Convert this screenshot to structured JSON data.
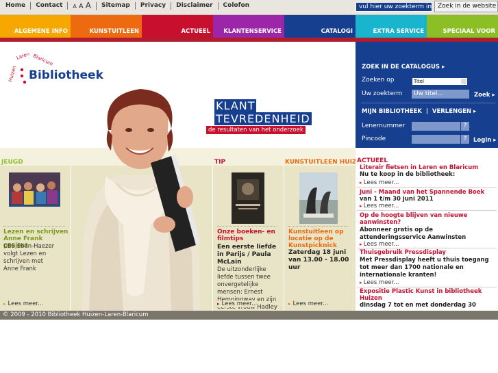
{
  "topnav": {
    "items": [
      "Home",
      "Contact",
      "Sitemap",
      "Privacy",
      "Disclaimer",
      "Colofon"
    ],
    "font_sizes": [
      "A",
      "A",
      "A"
    ]
  },
  "search": {
    "placeholder": "vul hier uw zoekterm in",
    "button": "Zoek in de website"
  },
  "colornav": [
    {
      "label": "ALGEMENE INFO",
      "color": "#f6a800"
    },
    {
      "label": "KUNSTUITLEEN",
      "color": "#ee6a10"
    },
    {
      "label": "ACTUEEL",
      "color": "#c8102e"
    },
    {
      "label": "KLANTENSERVICE",
      "color": "#9b27a8"
    },
    {
      "label": "CATALOGI",
      "color": "#173f8f"
    },
    {
      "label": "EXTRA SERVICE",
      "color": "#19b5cf"
    },
    {
      "label": "SPECIAAL VOOR",
      "color": "#8cbf26"
    }
  ],
  "logo": {
    "name": "Bibliotheek",
    "arc": "Huizen • Laren • Blaricum"
  },
  "banner": {
    "line1": "KLANT",
    "line2": "TEVREDENHEID",
    "line3": "de resultaten van het onderzoek"
  },
  "catalog_panel": {
    "heading": "ZOEK IN DE CATALOGUS",
    "search_on_label": "Zoeken op",
    "search_on_value": "Titel",
    "term_label": "Uw zoekterm",
    "term_placeholder": "Uw titel...",
    "search_button": "Zoek",
    "my_library": "MIJN BIBLIOTHEEK",
    "extend": "VERLENGEN",
    "member_label": "Lenernummer",
    "pin_label": "Pincode",
    "help": "?",
    "login_button": "Login"
  },
  "columns": {
    "jeugd": {
      "heading": "JEUGD",
      "title": "Lezen en schrijven Anne Frank project",
      "text": "CBS Eben-Haezer volgt Lezen en schrijven met Anne Frank",
      "more": "Lees meer..."
    },
    "tip": {
      "heading": "TIP",
      "title": "Onze boeken- en filmtips",
      "subtitle": "Een eerste liefde in Parijs / Paula McLain",
      "text": "De uitzonderlijke liefde tussen twee onvergetelijke mensen: Ernest Hemningway en zijn eerste vrouw Hadley",
      "more": "Lees meer..."
    },
    "kunst": {
      "heading": "KUNSTUITLEEN HUIZEN",
      "title": "Kunstuitleen op locatie op de Kunstpicknick",
      "text": "Zaterdag 18 juni van 13.00 - 18.00 uur",
      "more": "Lees meer..."
    }
  },
  "actueel": {
    "heading": "ACTUEEL",
    "items": [
      {
        "title": "Literair fietsen in Laren en Blaricum",
        "text": "Nu te koop in de bibliotheek:",
        "more": "Lees meer..."
      },
      {
        "title": "Juni - Maand van het Spannende Boek",
        "text": "van 1 t/m 30 juni 2011",
        "more": "Lees meer..."
      },
      {
        "title": "Op de hoogte blijven van nieuwe aanwinsten?",
        "text": "Abonneer gratis op de attenderingsservice Aanwinsten",
        "more": "Lees meer..."
      },
      {
        "title": "Thuisgebruik Pressdisplay",
        "text": "Met Pressdisplay heeft u thuis toegang tot meer dan 1700 nationale en internationale kranten!",
        "more": "Lees meer..."
      },
      {
        "title": "Expositie Plastic Kunst in bibliotheek Huizen",
        "text": "dinsdag 7 tot en met donderdag 30",
        "more": ""
      }
    ]
  },
  "footer": "© 2009 - 2010 Bibliotheek Huizen-Laren-Blaricum"
}
